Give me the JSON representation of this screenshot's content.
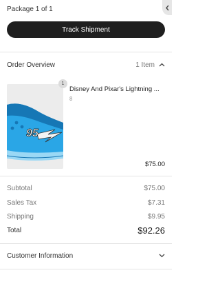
{
  "package": {
    "label": "Package 1 of 1"
  },
  "track_button": {
    "label": "Track Shipment"
  },
  "order_overview": {
    "title": "Order Overview",
    "count": "1 Item",
    "chevron": "chevron-up-icon"
  },
  "product": {
    "quantity": "1",
    "name": "Disney And Pixar's Lightning ...",
    "size": "8",
    "price": "$75.00",
    "image": "shoe-image",
    "image_text": "95",
    "colors": {
      "shoe": "#2aa6e6",
      "shoe_dark": "#1677b5",
      "sole": "#9ad8f5"
    }
  },
  "summary": {
    "subtotal": {
      "label": "Subtotal",
      "value": "$75.00"
    },
    "tax": {
      "label": "Sales Tax",
      "value": "$7.31"
    },
    "shipping": {
      "label": "Shipping",
      "value": "$9.95"
    },
    "total": {
      "label": "Total",
      "value": "$92.26"
    }
  },
  "customer_info": {
    "title": "Customer Information",
    "chevron": "chevron-down-icon"
  },
  "colors": {
    "button_bg": "#1f1f1f",
    "divider": "#e3e3e3",
    "muted_text": "#777777"
  }
}
